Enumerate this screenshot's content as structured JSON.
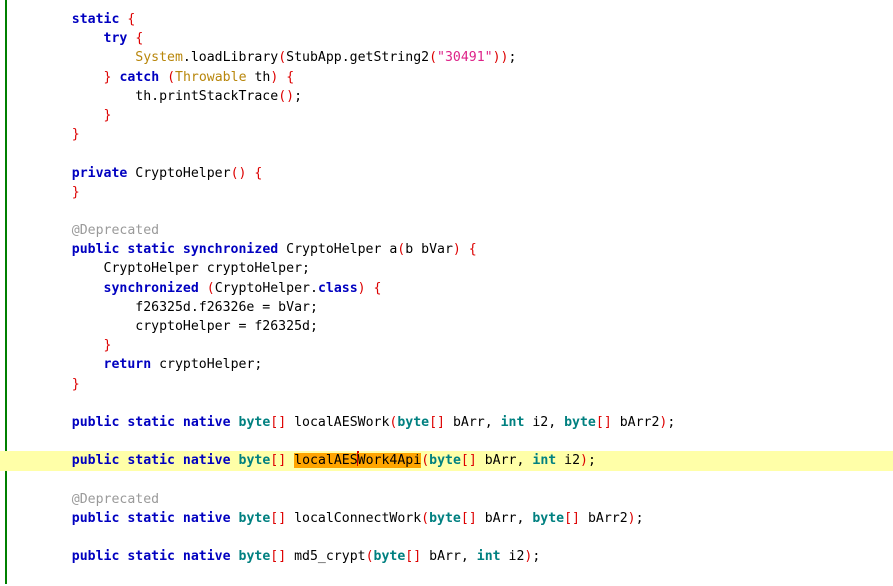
{
  "editor": {
    "language": "java",
    "file_name": "CryptoHelper.java",
    "gutter_marker_color": "#008000",
    "current_line_highlight_color": "#ffffa8",
    "selection_color": "#ffa500",
    "caret_color": "#dd0000",
    "background_color": "#ffffff",
    "colors": {
      "keyword": "#0000c0",
      "primitive_type": "#008080",
      "punctuation": "#dd0000",
      "class_name": "#b8860b",
      "string": "#dd2288",
      "annotation": "#9a9a9a",
      "plain_text": "#000000"
    }
  },
  "code": {
    "current_line_number": 24,
    "caret_token": "localAESWork4Api",
    "caret_offset_in_token": 8,
    "lines": [
      {
        "n": 1,
        "tokens": [
          {
            "t": "    ",
            "c": "plain"
          },
          {
            "t": "static",
            "c": "kw"
          },
          {
            "t": " ",
            "c": "plain"
          },
          {
            "t": "{",
            "c": "punct"
          }
        ]
      },
      {
        "n": 2,
        "tokens": [
          {
            "t": "        ",
            "c": "plain"
          },
          {
            "t": "try",
            "c": "kw"
          },
          {
            "t": " ",
            "c": "plain"
          },
          {
            "t": "{",
            "c": "punct"
          }
        ]
      },
      {
        "n": 3,
        "tokens": [
          {
            "t": "            ",
            "c": "plain"
          },
          {
            "t": "System",
            "c": "cls"
          },
          {
            "t": ".loadLibrary",
            "c": "plain"
          },
          {
            "t": "(",
            "c": "punct"
          },
          {
            "t": "StubApp.getString2",
            "c": "plain"
          },
          {
            "t": "(",
            "c": "punct"
          },
          {
            "t": "\"30491\"",
            "c": "str"
          },
          {
            "t": "))",
            "c": "punct"
          },
          {
            "t": ";",
            "c": "plain"
          }
        ]
      },
      {
        "n": 4,
        "tokens": [
          {
            "t": "        ",
            "c": "plain"
          },
          {
            "t": "}",
            "c": "punct"
          },
          {
            "t": " ",
            "c": "plain"
          },
          {
            "t": "catch",
            "c": "kw"
          },
          {
            "t": " ",
            "c": "plain"
          },
          {
            "t": "(",
            "c": "punct"
          },
          {
            "t": "Throwable",
            "c": "cls"
          },
          {
            "t": " th",
            "c": "plain"
          },
          {
            "t": ")",
            "c": "punct"
          },
          {
            "t": " ",
            "c": "plain"
          },
          {
            "t": "{",
            "c": "punct"
          }
        ]
      },
      {
        "n": 5,
        "tokens": [
          {
            "t": "            th.printStackTrace",
            "c": "plain"
          },
          {
            "t": "()",
            "c": "punct"
          },
          {
            "t": ";",
            "c": "plain"
          }
        ]
      },
      {
        "n": 6,
        "tokens": [
          {
            "t": "        ",
            "c": "plain"
          },
          {
            "t": "}",
            "c": "punct"
          }
        ]
      },
      {
        "n": 7,
        "tokens": [
          {
            "t": "    ",
            "c": "plain"
          },
          {
            "t": "}",
            "c": "punct"
          }
        ]
      },
      {
        "n": 8,
        "tokens": []
      },
      {
        "n": 9,
        "tokens": [
          {
            "t": "    ",
            "c": "plain"
          },
          {
            "t": "private",
            "c": "kw"
          },
          {
            "t": " CryptoHelper",
            "c": "plain"
          },
          {
            "t": "()",
            "c": "punct"
          },
          {
            "t": " ",
            "c": "plain"
          },
          {
            "t": "{",
            "c": "punct"
          }
        ]
      },
      {
        "n": 10,
        "tokens": [
          {
            "t": "    ",
            "c": "plain"
          },
          {
            "t": "}",
            "c": "punct"
          }
        ]
      },
      {
        "n": 11,
        "tokens": []
      },
      {
        "n": 12,
        "tokens": [
          {
            "t": "    ",
            "c": "plain"
          },
          {
            "t": "@Deprecated",
            "c": "anno"
          }
        ]
      },
      {
        "n": 13,
        "tokens": [
          {
            "t": "    ",
            "c": "plain"
          },
          {
            "t": "public static synchronized",
            "c": "kw"
          },
          {
            "t": " CryptoHelper a",
            "c": "plain"
          },
          {
            "t": "(",
            "c": "punct"
          },
          {
            "t": "b bVar",
            "c": "plain"
          },
          {
            "t": ")",
            "c": "punct"
          },
          {
            "t": " ",
            "c": "plain"
          },
          {
            "t": "{",
            "c": "punct"
          }
        ]
      },
      {
        "n": 14,
        "tokens": [
          {
            "t": "        CryptoHelper cryptoHelper;",
            "c": "plain"
          }
        ]
      },
      {
        "n": 15,
        "tokens": [
          {
            "t": "        ",
            "c": "plain"
          },
          {
            "t": "synchronized",
            "c": "kw"
          },
          {
            "t": " ",
            "c": "plain"
          },
          {
            "t": "(",
            "c": "punct"
          },
          {
            "t": "CryptoHelper.",
            "c": "plain"
          },
          {
            "t": "class",
            "c": "kw"
          },
          {
            "t": ")",
            "c": "punct"
          },
          {
            "t": " ",
            "c": "plain"
          },
          {
            "t": "{",
            "c": "punct"
          }
        ]
      },
      {
        "n": 16,
        "tokens": [
          {
            "t": "            f26325d.f26326e = bVar;",
            "c": "plain"
          }
        ]
      },
      {
        "n": 17,
        "tokens": [
          {
            "t": "            cryptoHelper = f26325d;",
            "c": "plain"
          }
        ]
      },
      {
        "n": 18,
        "tokens": [
          {
            "t": "        ",
            "c": "plain"
          },
          {
            "t": "}",
            "c": "punct"
          }
        ]
      },
      {
        "n": 19,
        "tokens": [
          {
            "t": "        ",
            "c": "plain"
          },
          {
            "t": "return",
            "c": "kw"
          },
          {
            "t": " cryptoHelper;",
            "c": "plain"
          }
        ]
      },
      {
        "n": 20,
        "tokens": [
          {
            "t": "    ",
            "c": "plain"
          },
          {
            "t": "}",
            "c": "punct"
          }
        ]
      },
      {
        "n": 21,
        "tokens": []
      },
      {
        "n": 22,
        "tokens": [
          {
            "t": "    ",
            "c": "plain"
          },
          {
            "t": "public static native",
            "c": "kw"
          },
          {
            "t": " ",
            "c": "plain"
          },
          {
            "t": "byte",
            "c": "type"
          },
          {
            "t": "[]",
            "c": "punct"
          },
          {
            "t": " localAESWork",
            "c": "plain"
          },
          {
            "t": "(",
            "c": "punct"
          },
          {
            "t": "byte",
            "c": "type"
          },
          {
            "t": "[]",
            "c": "punct"
          },
          {
            "t": " bArr, ",
            "c": "plain"
          },
          {
            "t": "int",
            "c": "type"
          },
          {
            "t": " i2, ",
            "c": "plain"
          },
          {
            "t": "byte",
            "c": "type"
          },
          {
            "t": "[]",
            "c": "punct"
          },
          {
            "t": " bArr2",
            "c": "plain"
          },
          {
            "t": ")",
            "c": "punct"
          },
          {
            "t": ";",
            "c": "plain"
          }
        ]
      },
      {
        "n": 23,
        "tokens": []
      },
      {
        "n": 24,
        "current": true,
        "tokens": [
          {
            "t": "    ",
            "c": "plain"
          },
          {
            "t": "public static native",
            "c": "kw"
          },
          {
            "t": " ",
            "c": "plain"
          },
          {
            "t": "byte",
            "c": "type"
          },
          {
            "t": "[]",
            "c": "punct"
          },
          {
            "t": " ",
            "c": "plain"
          },
          {
            "t": "localAES",
            "c": "sel"
          },
          {
            "t": "",
            "c": "caret"
          },
          {
            "t": "Work4Api",
            "c": "sel"
          },
          {
            "t": "(",
            "c": "punct"
          },
          {
            "t": "byte",
            "c": "type"
          },
          {
            "t": "[]",
            "c": "punct"
          },
          {
            "t": " bArr, ",
            "c": "plain"
          },
          {
            "t": "int",
            "c": "type"
          },
          {
            "t": " i2",
            "c": "plain"
          },
          {
            "t": ")",
            "c": "punct"
          },
          {
            "t": ";",
            "c": "plain"
          }
        ]
      },
      {
        "n": 25,
        "tokens": []
      },
      {
        "n": 26,
        "tokens": [
          {
            "t": "    ",
            "c": "plain"
          },
          {
            "t": "@Deprecated",
            "c": "anno"
          }
        ]
      },
      {
        "n": 27,
        "tokens": [
          {
            "t": "    ",
            "c": "plain"
          },
          {
            "t": "public static native",
            "c": "kw"
          },
          {
            "t": " ",
            "c": "plain"
          },
          {
            "t": "byte",
            "c": "type"
          },
          {
            "t": "[]",
            "c": "punct"
          },
          {
            "t": " localConnectWork",
            "c": "plain"
          },
          {
            "t": "(",
            "c": "punct"
          },
          {
            "t": "byte",
            "c": "type"
          },
          {
            "t": "[]",
            "c": "punct"
          },
          {
            "t": " bArr, ",
            "c": "plain"
          },
          {
            "t": "byte",
            "c": "type"
          },
          {
            "t": "[]",
            "c": "punct"
          },
          {
            "t": " bArr2",
            "c": "plain"
          },
          {
            "t": ")",
            "c": "punct"
          },
          {
            "t": ";",
            "c": "plain"
          }
        ]
      },
      {
        "n": 28,
        "tokens": []
      },
      {
        "n": 29,
        "tokens": [
          {
            "t": "    ",
            "c": "plain"
          },
          {
            "t": "public static native",
            "c": "kw"
          },
          {
            "t": " ",
            "c": "plain"
          },
          {
            "t": "byte",
            "c": "type"
          },
          {
            "t": "[]",
            "c": "punct"
          },
          {
            "t": " md5_crypt",
            "c": "plain"
          },
          {
            "t": "(",
            "c": "punct"
          },
          {
            "t": "byte",
            "c": "type"
          },
          {
            "t": "[]",
            "c": "punct"
          },
          {
            "t": " bArr, ",
            "c": "plain"
          },
          {
            "t": "int",
            "c": "type"
          },
          {
            "t": " i2",
            "c": "plain"
          },
          {
            "t": ")",
            "c": "punct"
          },
          {
            "t": ";",
            "c": "plain"
          }
        ]
      },
      {
        "n": 30,
        "tokens": []
      }
    ]
  }
}
